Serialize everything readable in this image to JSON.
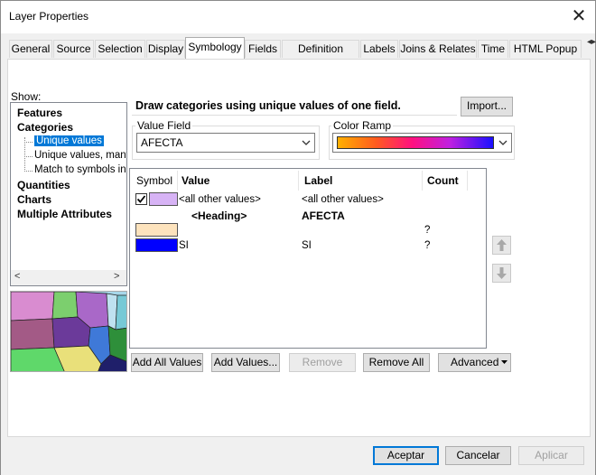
{
  "window": {
    "title": "Layer Properties",
    "close_glyph": "✕"
  },
  "tabs": [
    {
      "label": "General"
    },
    {
      "label": "Source"
    },
    {
      "label": "Selection"
    },
    {
      "label": "Display"
    },
    {
      "label": "Symbology",
      "active": true
    },
    {
      "label": "Fields"
    },
    {
      "label": "Definition Query"
    },
    {
      "label": "Labels"
    },
    {
      "label": "Joins & Relates"
    },
    {
      "label": "Time"
    },
    {
      "label": "HTML Popup"
    }
  ],
  "show": {
    "label": "Show:",
    "items": [
      "Features",
      "Categories",
      "Quantities",
      "Charts",
      "Multiple Attributes"
    ],
    "category_subitems": [
      "Unique values",
      "Unique values, many",
      "Match to symbols in a"
    ]
  },
  "description": "Draw categories using unique values of one field.",
  "import_button": "Import...",
  "value_field": {
    "label": "Value Field",
    "value": "AFECTA"
  },
  "color_ramp": {
    "label": "Color Ramp",
    "colors": [
      "#ffb000",
      "#ff1080",
      "#1a10ff"
    ]
  },
  "table": {
    "headers": {
      "symbol": "Symbol",
      "value": "Value",
      "label": "Label",
      "count": "Count"
    },
    "rows": [
      {
        "checked": true,
        "swatch": "#d7b3f5",
        "value": "<all other values>",
        "label": "<all other values>",
        "count": ""
      },
      {
        "heading": true,
        "value": "<Heading>",
        "label": "AFECTA",
        "count": ""
      },
      {
        "swatch": "#fde3bd",
        "value": "",
        "label": "",
        "count": "?"
      },
      {
        "swatch": "#0000ff",
        "value": "SI",
        "label": "SI",
        "count": "?"
      }
    ]
  },
  "buttons": {
    "add_all_values": "Add All Values",
    "add_values": "Add Values...",
    "remove": "Remove",
    "remove_all": "Remove All",
    "advanced": "Advanced",
    "ok": "Aceptar",
    "cancel": "Cancelar",
    "apply": "Aplicar"
  }
}
